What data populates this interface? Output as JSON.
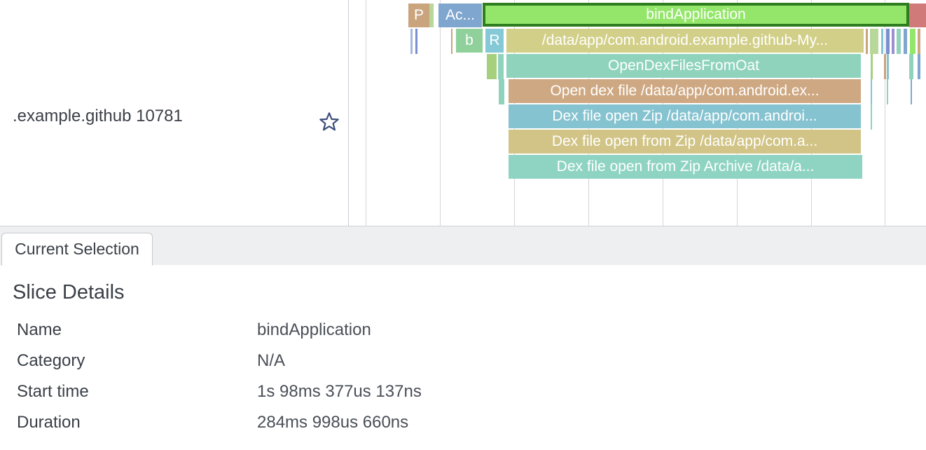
{
  "track": {
    "title": ".example.github 10781"
  },
  "slices": [
    {
      "label": "P",
      "color": "#c9a47d"
    },
    {
      "label": "Ac...",
      "color": "#7fa6cf"
    },
    {
      "label": "bindApplication",
      "color": "#94e66a"
    },
    {
      "label": "b",
      "color": "#8fd09b"
    },
    {
      "label": "R",
      "color": "#86c9d6"
    },
    {
      "label": "/data/app/com.android.example.github-My...",
      "color": "#d2cf88"
    },
    {
      "label": "OpenDexFilesFromOat",
      "color": "#8fd3bd"
    },
    {
      "label": "Open dex file /data/app/com.android.ex...",
      "color": "#cea882"
    },
    {
      "label": "Dex file open Zip /data/app/com.androi...",
      "color": "#86c3d0"
    },
    {
      "label": "Dex file open from Zip /data/app/com.a...",
      "color": "#d1c486"
    },
    {
      "label": "Dex file open from Zip Archive /data/a...",
      "color": "#8fd4c2"
    }
  ],
  "tabs": {
    "current_selection": "Current Selection"
  },
  "details": {
    "title": "Slice Details",
    "rows": [
      {
        "key": "Name",
        "value": "bindApplication"
      },
      {
        "key": "Category",
        "value": "N/A"
      },
      {
        "key": "Start time",
        "value": "1s 98ms 377us 137ns"
      },
      {
        "key": "Duration",
        "value": "284ms 998us 660ns"
      }
    ]
  },
  "colors": {
    "selected_border": "#2e7d1f",
    "star": "#3a4a7a"
  }
}
